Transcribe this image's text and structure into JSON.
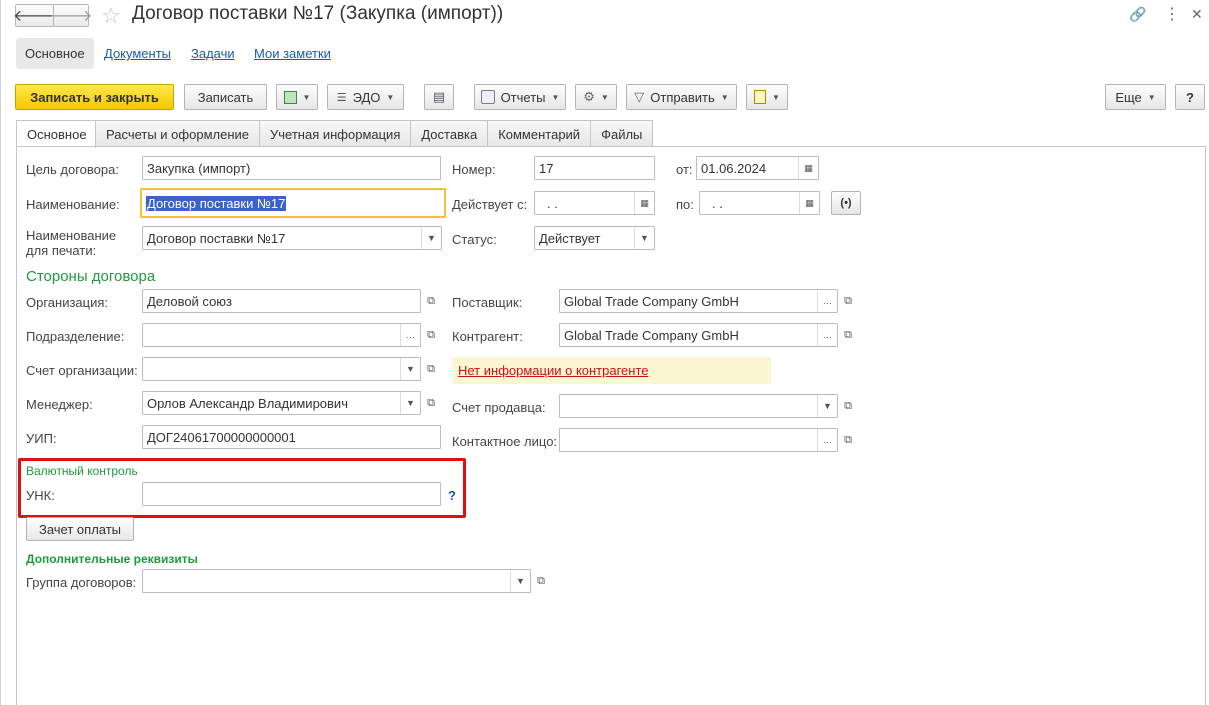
{
  "window": {
    "title": "Договор поставки №17 (Закупка (импорт))"
  },
  "sections": [
    {
      "label": "Основное"
    },
    {
      "label": "Документы"
    },
    {
      "label": "Задачи"
    },
    {
      "label": "Мои заметки"
    }
  ],
  "toolbar": {
    "save_close": "Записать и закрыть",
    "save": "Записать",
    "edo": "ЭДО",
    "reports": "Отчеты",
    "send": "Отправить",
    "more": "Еще",
    "help": "?"
  },
  "tabs": [
    {
      "label": "Основное"
    },
    {
      "label": "Расчеты и оформление"
    },
    {
      "label": "Учетная информация"
    },
    {
      "label": "Доставка"
    },
    {
      "label": "Комментарий"
    },
    {
      "label": "Файлы"
    }
  ],
  "form": {
    "purpose": {
      "label": "Цель договора:",
      "value": "Закупка (импорт)"
    },
    "number": {
      "label": "Номер:",
      "value": "17"
    },
    "date": {
      "label": "от:",
      "value": "01.06.2024"
    },
    "name": {
      "label": "Наименование:",
      "value": "Договор поставки №17"
    },
    "valid_from": {
      "label": "Действует с:",
      "value": " .  ."
    },
    "valid_to": {
      "label": "по:",
      "value": " .  ."
    },
    "print_name": {
      "label_line1": "Наименование",
      "label_line2": "для печати:",
      "value": "Договор поставки №17"
    },
    "status": {
      "label": "Статус:",
      "value": "Действует"
    },
    "parties_heading": "Стороны договора",
    "organization": {
      "label": "Организация:",
      "value": "Деловой союз"
    },
    "supplier": {
      "label": "Поставщик:",
      "value": "Global Trade Company GmbH"
    },
    "division": {
      "label": "Подразделение:",
      "value": ""
    },
    "counterparty": {
      "label": "Контрагент:",
      "value": "Global Trade Company GmbH"
    },
    "org_account": {
      "label": "Счет организации:",
      "value": ""
    },
    "no_info_link": "Нет информации о контрагенте",
    "manager": {
      "label": "Менеджер:",
      "value": "Орлов Александр Владимирович"
    },
    "seller_account": {
      "label": "Счет продавца:",
      "value": ""
    },
    "uip": {
      "label": "УИП:",
      "value": "ДОГ24061700000000001"
    },
    "contact": {
      "label": "Контактное лицо:",
      "value": ""
    },
    "currency_heading": "Валютный контроль",
    "unk": {
      "label": "УНК:",
      "value": "",
      "help": "?"
    },
    "offset_button": "Зачет оплаты",
    "extra_heading": "Дополнительные реквизиты",
    "contract_group": {
      "label": "Группа договоров:",
      "value": ""
    }
  }
}
